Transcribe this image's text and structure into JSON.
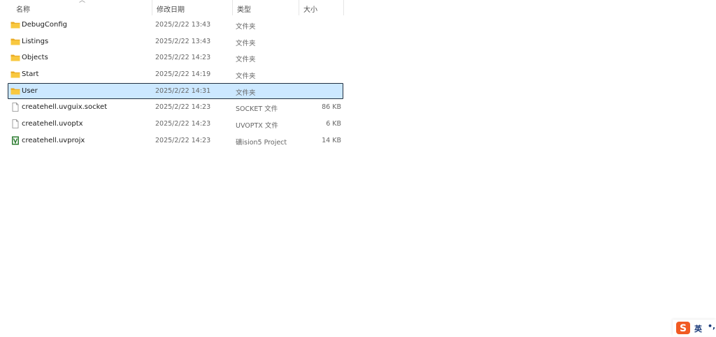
{
  "columns": {
    "name": "名称",
    "date": "修改日期",
    "type": "类型",
    "size": "大小"
  },
  "files": [
    {
      "name": "DebugConfig",
      "date": "2025/2/22 13:43",
      "type": "文件夹",
      "size": "",
      "icon": "folder-icon",
      "selected": false
    },
    {
      "name": "Listings",
      "date": "2025/2/22 13:43",
      "type": "文件夹",
      "size": "",
      "icon": "folder-icon",
      "selected": false
    },
    {
      "name": "Objects",
      "date": "2025/2/22 14:23",
      "type": "文件夹",
      "size": "",
      "icon": "folder-icon",
      "selected": false
    },
    {
      "name": "Start",
      "date": "2025/2/22 14:19",
      "type": "文件夹",
      "size": "",
      "icon": "folder-icon",
      "selected": false
    },
    {
      "name": "User",
      "date": "2025/2/22 14:31",
      "type": "文件夹",
      "size": "",
      "icon": "folder-icon",
      "selected": true
    },
    {
      "name": "createhell.uvguix.socket",
      "date": "2025/2/22 14:23",
      "type": "SOCKET 文件",
      "size": "86 KB",
      "icon": "file-icon",
      "selected": false
    },
    {
      "name": "createhell.uvoptx",
      "date": "2025/2/22 14:23",
      "type": "UVOPTX 文件",
      "size": "6 KB",
      "icon": "file-icon",
      "selected": false
    },
    {
      "name": "createhell.uvprojx",
      "date": "2025/2/22 14:23",
      "type": "礦ision5 Project",
      "size": "14 KB",
      "icon": "uvision-project-icon",
      "selected": false
    }
  ],
  "ime": {
    "lang": "英",
    "punct": "•,"
  },
  "colors": {
    "folder": "#f8c840",
    "folder_dark": "#e8a820",
    "selection_bg": "#cce8ff",
    "selection_border": "#1f2f40",
    "ime_logo": "#f15a22",
    "uvision_green": "#2e7d32"
  }
}
